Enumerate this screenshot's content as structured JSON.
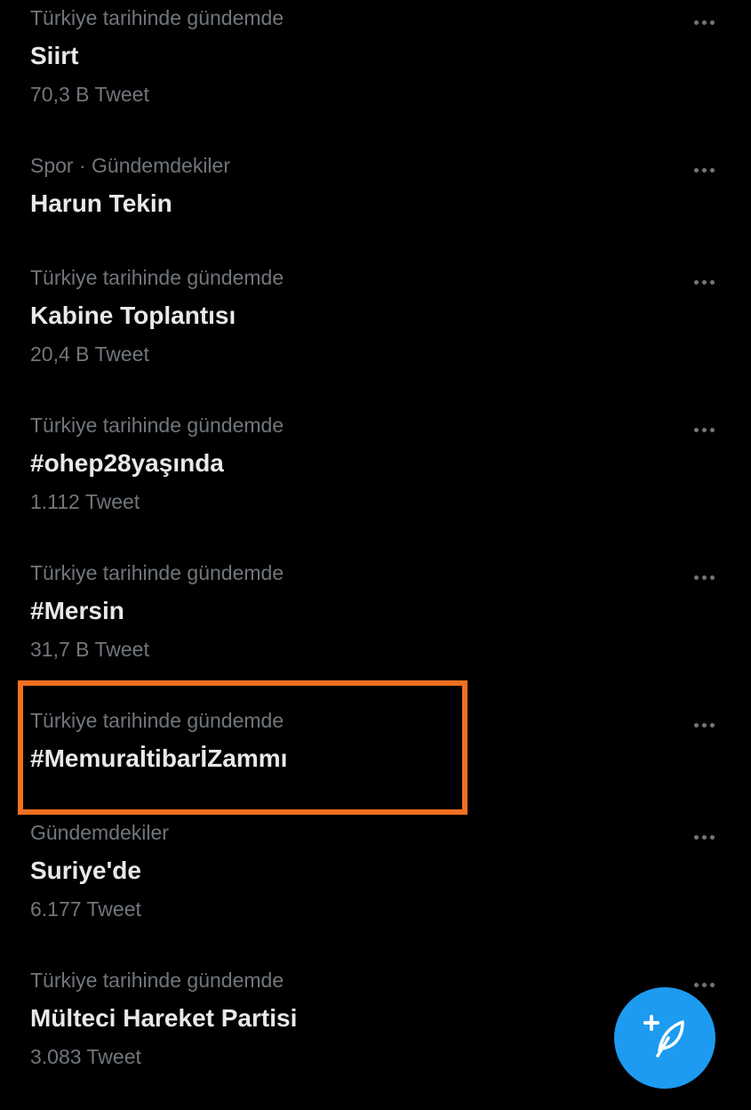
{
  "trends": [
    {
      "context": "Türkiye tarihinde gündemde",
      "title": "Siirt",
      "count": "70,3 B Tweet"
    },
    {
      "context": "Spor · Gündemdekiler",
      "title": "Harun Tekin",
      "count": ""
    },
    {
      "context": "Türkiye tarihinde gündemde",
      "title": "Kabine Toplantısı",
      "count": "20,4 B Tweet"
    },
    {
      "context": "Türkiye tarihinde gündemde",
      "title": "#ohep28yaşında",
      "count": "1.112 Tweet"
    },
    {
      "context": "Türkiye tarihinde gündemde",
      "title": "#Mersin",
      "count": "31,7 B Tweet"
    },
    {
      "context": "Türkiye tarihinde gündemde",
      "title": "#MemuraİtibarİZammı",
      "count": ""
    },
    {
      "context": "Gündemdekiler",
      "title": "Suriye'de",
      "count": "6.177 Tweet"
    },
    {
      "context": "Türkiye tarihinde gündemde",
      "title": "Mülteci Hareket Partisi",
      "count": "3.083 Tweet"
    }
  ],
  "icons": {
    "more": "more-horizontal-icon",
    "compose": "compose-feather-icon"
  },
  "colors": {
    "background": "#000000",
    "primary_text": "#e7e9ea",
    "secondary_text": "#71767b",
    "accent": "#1d9bf0",
    "highlight": "#f36f21"
  }
}
